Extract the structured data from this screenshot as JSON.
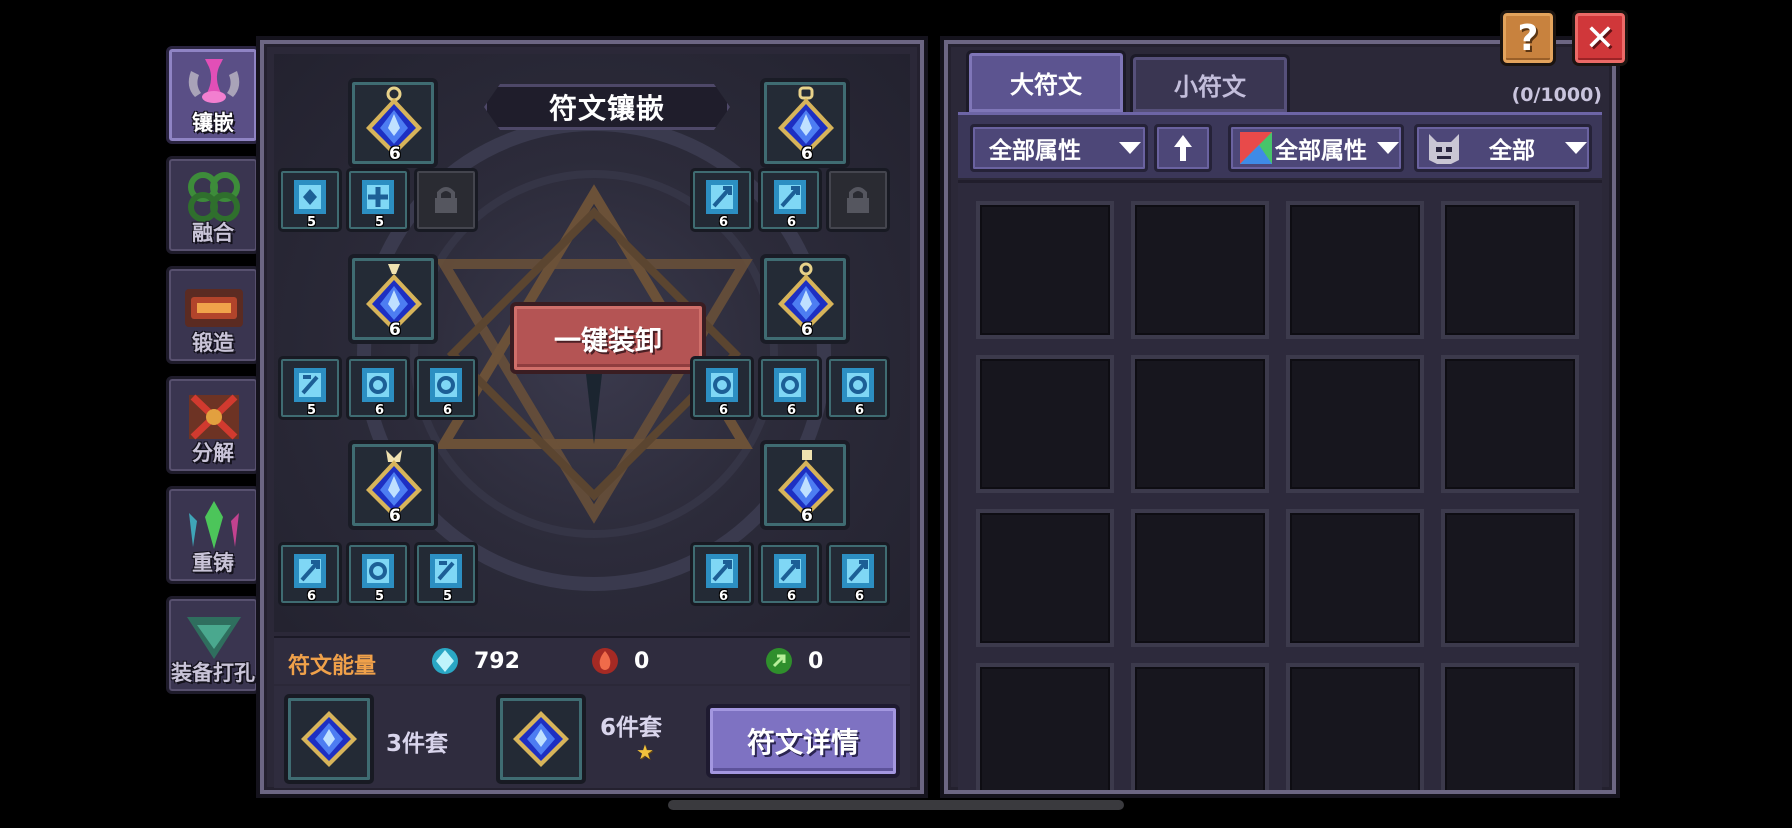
{
  "sidebar": {
    "tabs": [
      {
        "label": "镶嵌",
        "icon": "rune-inlay-icon",
        "active": true
      },
      {
        "label": "融合",
        "icon": "fusion-icon",
        "active": false
      },
      {
        "label": "锻造",
        "icon": "forge-icon",
        "active": false
      },
      {
        "label": "分解",
        "icon": "decompose-icon",
        "active": false
      },
      {
        "label": "重铸",
        "icon": "recast-icon",
        "active": false
      },
      {
        "label": "装备打孔",
        "icon": "equip-punch-icon",
        "active": false
      }
    ]
  },
  "left": {
    "title": "符文镶嵌",
    "unequip_label": "一键装卸",
    "big_runes": [
      {
        "level": "6"
      },
      {
        "level": "6"
      },
      {
        "level": "6"
      },
      {
        "level": "6"
      },
      {
        "level": "6"
      },
      {
        "level": "6"
      }
    ],
    "small_runes": {
      "row1_left": [
        "5",
        "5"
      ],
      "row1_right": [
        "6",
        "6"
      ],
      "row2_left": [
        "5",
        "6",
        "6"
      ],
      "row2_right": [
        "6",
        "6",
        "6"
      ],
      "row3_left": [
        "6",
        "5",
        "5"
      ],
      "row3_right": [
        "6",
        "6",
        "6"
      ]
    },
    "energy": {
      "label": "符文能量",
      "items": [
        {
          "icon": "blue-crystal-icon",
          "value": "792",
          "color": "#8fe6f0"
        },
        {
          "icon": "red-flame-icon",
          "value": "0",
          "color": "#e0473c"
        },
        {
          "icon": "green-crystal-icon",
          "value": "0",
          "color": "#58c040"
        }
      ]
    },
    "sets": [
      {
        "label": "3件套",
        "star": false
      },
      {
        "label": "6件套",
        "star": true
      }
    ],
    "detail_label": "符文详情"
  },
  "right": {
    "tabs": [
      {
        "label": "大符文",
        "active": true
      },
      {
        "label": "小符文",
        "active": false
      }
    ],
    "count": "(0/1000)",
    "filters": {
      "attribute": "全部属性",
      "sort_icon": "arrow-up-icon",
      "element": "全部属性",
      "type": "全部"
    }
  },
  "buttons": {
    "help": "?",
    "close": "✕"
  },
  "colors": {
    "accent_purple": "#7e72c2",
    "unequip_red": "#b45454",
    "energy_orange": "#f0a14a",
    "help_orange": "#c8823e",
    "close_red": "#d0373a"
  }
}
